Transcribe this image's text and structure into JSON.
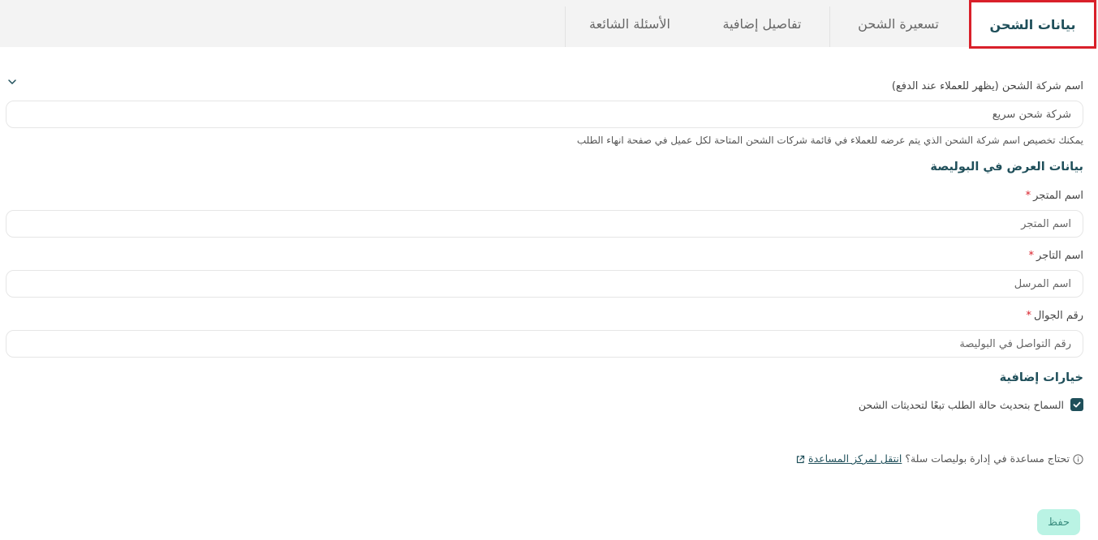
{
  "tabs": [
    {
      "label": "بيانات الشحن",
      "active": true
    },
    {
      "label": "تسعيرة الشحن",
      "active": false
    },
    {
      "label": "تفاصيل إضافية",
      "active": false
    },
    {
      "label": "الأسئلة الشائعة",
      "active": false
    }
  ],
  "form": {
    "company_name": {
      "label": "اسم شركة الشحن (يظهر للعملاء عند الدفع)",
      "value": "شركة شحن سريع",
      "hint": "يمكنك تخصيص اسم شركة الشحن الذي يتم عرضه للعملاء في قائمة شركات الشحن المتاحة لكل عميل في صفحة انهاء الطلب"
    },
    "waybill_section_title": "بيانات العرض في البوليصة",
    "store_name": {
      "label": "اسم المتجر",
      "required_mark": "*",
      "placeholder": "اسم المتجر"
    },
    "merchant_name": {
      "label": "اسم التاجر",
      "required_mark": "*",
      "placeholder": "اسم المرسل"
    },
    "mobile": {
      "label": "رقم الجوال",
      "required_mark": "*",
      "placeholder": "رقم التواصل في البوليصة"
    },
    "extra_options_title": "خيارات إضافية",
    "allow_status_update": {
      "label": "السماح بتحديث حالة الطلب تبعًا لتحديثات الشحن",
      "checked": true
    }
  },
  "help": {
    "text": "تحتاج مساعدة في إدارة بوليصات سلة؟",
    "link_text": "انتقل لمركز المساعدة"
  },
  "save_label": "حفظ",
  "colors": {
    "primary": "#1f4f5a",
    "tab_highlight_border": "#d9202a",
    "required": "#d9202a",
    "save_bg": "#baf3e4",
    "save_text": "#3b8e80"
  }
}
